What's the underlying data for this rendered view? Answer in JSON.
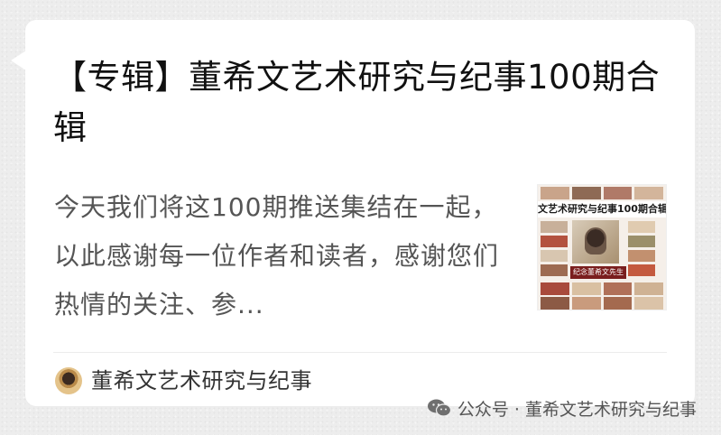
{
  "article": {
    "title": "【专辑】董希文艺术研究与纪事100期合辑",
    "summary": "今天我们将这100期推送集结在一起，以此感谢每一位作者和读者，感谢您们热情的关注、参..."
  },
  "thumbnail": {
    "banner_text": "文艺术研究与纪事100期合辑",
    "caption_text": "纪念董希文先生"
  },
  "author": {
    "name": "董希文艺术研究与纪事"
  },
  "watermark": {
    "text": "公众号 · 董希文艺术研究与纪事",
    "icon": "wechat-icon"
  },
  "colors": {
    "card_bg": "#ffffff",
    "page_bg": "#ededed",
    "title_color": "#111111",
    "summary_color": "#555555"
  }
}
